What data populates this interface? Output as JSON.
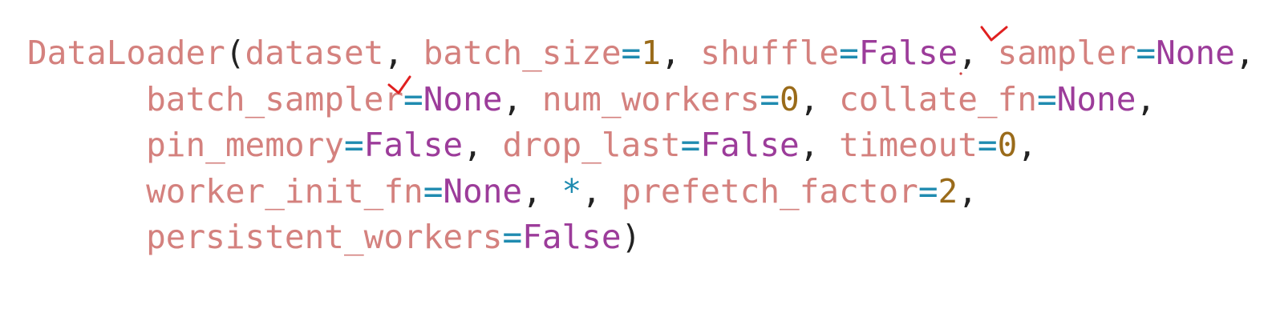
{
  "code": {
    "function_name": "DataLoader",
    "open_paren": "(",
    "close_paren": ")",
    "comma": ",",
    "equals": "=",
    "star": "*",
    "args": {
      "dataset": "dataset",
      "batch_size": {
        "name": "batch_size",
        "value": "1"
      },
      "shuffle": {
        "name": "shuffle",
        "value": "False"
      },
      "sampler": {
        "name": "sampler",
        "value": "None"
      },
      "batch_sampler": {
        "name": "batch_sampler",
        "value": "None"
      },
      "num_workers": {
        "name": "num_workers",
        "value": "0"
      },
      "collate_fn": {
        "name": "collate_fn",
        "value": "None"
      },
      "pin_memory": {
        "name": "pin_memory",
        "value": "False"
      },
      "drop_last": {
        "name": "drop_last",
        "value": "False"
      },
      "timeout": {
        "name": "timeout",
        "value": "0"
      },
      "worker_init_fn": {
        "name": "worker_init_fn",
        "value": "None"
      },
      "prefetch_factor": {
        "name": "prefetch_factor",
        "value": "2"
      },
      "persistent_workers": {
        "name": "persistent_workers",
        "value": "False"
      }
    }
  },
  "colors": {
    "name": "#d4817e",
    "operator": "#1f8bb0",
    "number": "#9a6b1a",
    "keyword": "#9c3c9a",
    "punctuation": "#222222",
    "checkmark": "#e02020"
  },
  "annotations": [
    "checkmark-icon",
    "checkmark-icon"
  ]
}
